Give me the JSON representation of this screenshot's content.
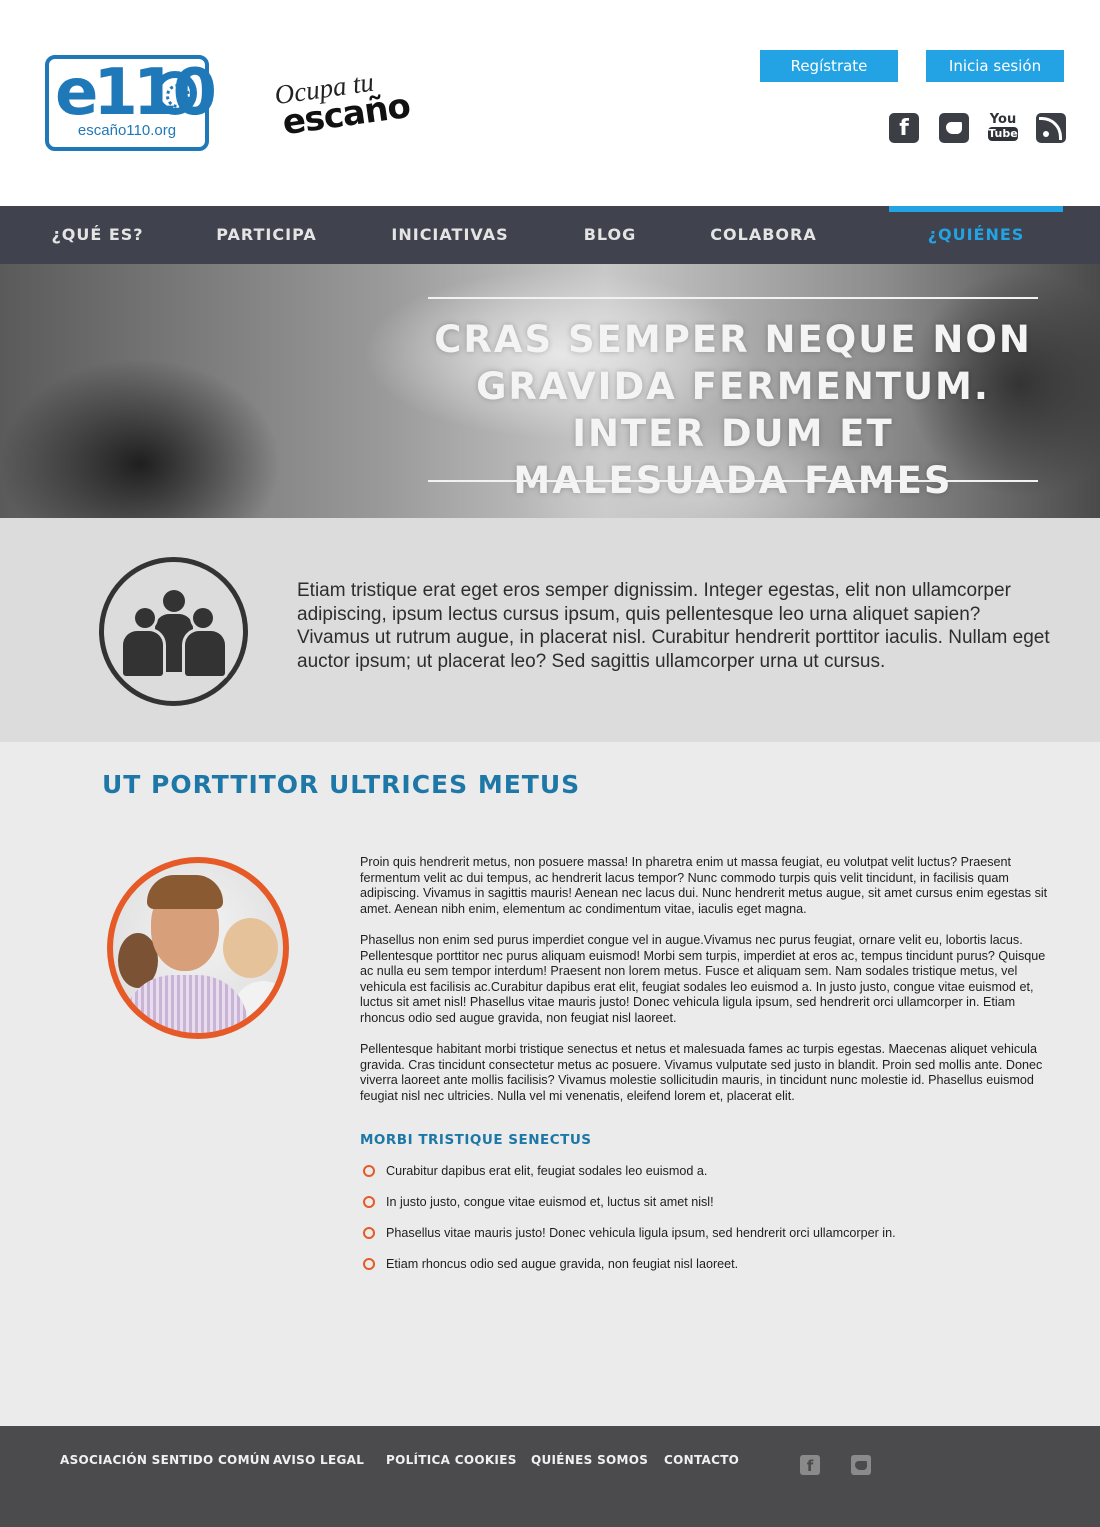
{
  "header": {
    "logo_e110": {
      "mark": "e110",
      "url_text": "escaño110.org"
    },
    "logo_ocupa": {
      "line1": "Ocupa tu",
      "line2": "escaño"
    },
    "register_label": "Regístrate",
    "login_label": "Inicia sesión",
    "social": [
      {
        "icon": "facebook-icon",
        "glyph": "f"
      },
      {
        "icon": "twitter-icon",
        "glyph": ""
      },
      {
        "icon": "youtube-icon",
        "glyph_top": "You",
        "glyph_bottom": "Tube"
      },
      {
        "icon": "rss-icon",
        "glyph": ""
      }
    ]
  },
  "nav": {
    "items": [
      {
        "label": "¿QUÉ ES?"
      },
      {
        "label": "PARTICIPA"
      },
      {
        "label": "INICIATIVAS"
      },
      {
        "label": "BLOG"
      },
      {
        "label": "COLABORA"
      },
      {
        "label": "¿QUIÉNES SOMOS?",
        "active": true
      }
    ]
  },
  "hero": {
    "title": "CRAS SEMPER NEQUE NON GRAVIDA FERMENTUM. INTER DUM ET MALESUADA FAMES"
  },
  "intro": {
    "icon": "group-people-icon",
    "text": "Etiam tristique erat eget eros semper dignissim. Integer egestas, elit non ullamcorper adipiscing, ipsum lectus cursus ipsum, quis pellentesque leo urna aliquet sapien? Vivamus ut rutrum augue, in placerat nisl. Curabitur hendrerit porttitor iaculis. Nullam eget auctor ipsum; ut placerat leo? Sed sagittis ullamcorper urna ut cursus."
  },
  "main": {
    "title": "UT PORTTITOR ULTRICES METUS",
    "paragraphs": [
      "Proin quis hendrerit metus, non posuere massa! In pharetra enim ut massa feugiat, eu volutpat velit luctus? Praesent fermentum velit ac dui tempus, ac hendrerit lacus tempor? Nunc commodo turpis quis velit tincidunt, in facilisis quam adipiscing. Vivamus in sagittis mauris! Aenean nec lacus dui. Nunc hendrerit metus augue, sit amet cursus enim egestas sit amet. Aenean nibh enim, elementum ac condimentum vitae, iaculis eget magna.",
      "Phasellus non enim sed purus imperdiet congue vel in augue.Vivamus nec purus feugiat, ornare velit eu, lobortis lacus. Pellentesque porttitor nec purus aliquam euismod! Morbi sem turpis, imperdiet at eros ac, tempus tincidunt purus? Quisque ac nulla eu sem tempor interdum! Praesent non lorem metus. Fusce et aliquam sem. Nam sodales tristique metus, vel vehicula est facilisis ac.Curabitur dapibus erat elit, feugiat sodales leo euismod a. In justo justo, congue vitae euismod et, luctus sit amet nisl! Phasellus vitae mauris justo! Donec vehicula ligula ipsum, sed hendrerit orci ullamcorper in. Etiam rhoncus odio sed augue gravida, non feugiat nisl laoreet.",
      "Pellentesque habitant morbi tristique senectus et netus et malesuada fames ac turpis egestas. Maecenas aliquet vehicula gravida. Cras tincidunt consectetur metus ac posuere. Vivamus vulputate sed justo in blandit. Proin sed mollis ante. Donec viverra laoreet ante mollis facilisis? Vivamus molestie sollicitudin mauris, in tincidunt nunc molestie id. Phasellus euismod feugiat nisl nec ultricies. Nulla vel mi venenatis, eleifend lorem et, placerat elit."
    ],
    "subtitle": "MORBI TRISTIQUE SENECTUS",
    "list": [
      "Curabitur dapibus erat elit, feugiat sodales leo euismod a.",
      "In justo justo, congue vitae euismod et, luctus sit amet nisl!",
      "Phasellus vitae mauris justo! Donec vehicula ligula ipsum, sed hendrerit orci ullamcorper in.",
      "Etiam rhoncus odio sed augue gravida, non feugiat nisl laoreet."
    ]
  },
  "footer": {
    "links": [
      "ASOCIACIÓN SENTIDO COMÚN",
      "AVISO LEGAL",
      "POLÍTICA COOKIES",
      "QUIÉNES SOMOS",
      "CONTACTO"
    ],
    "social": [
      {
        "icon": "facebook-icon",
        "glyph": "f"
      },
      {
        "icon": "twitter-icon",
        "glyph": ""
      }
    ]
  },
  "colors": {
    "accent_blue": "#23a3e4",
    "title_blue": "#1d77a7",
    "accent_orange": "#e55a27",
    "nav_bg": "#40434d",
    "footer_bg": "#4b4b4d"
  }
}
